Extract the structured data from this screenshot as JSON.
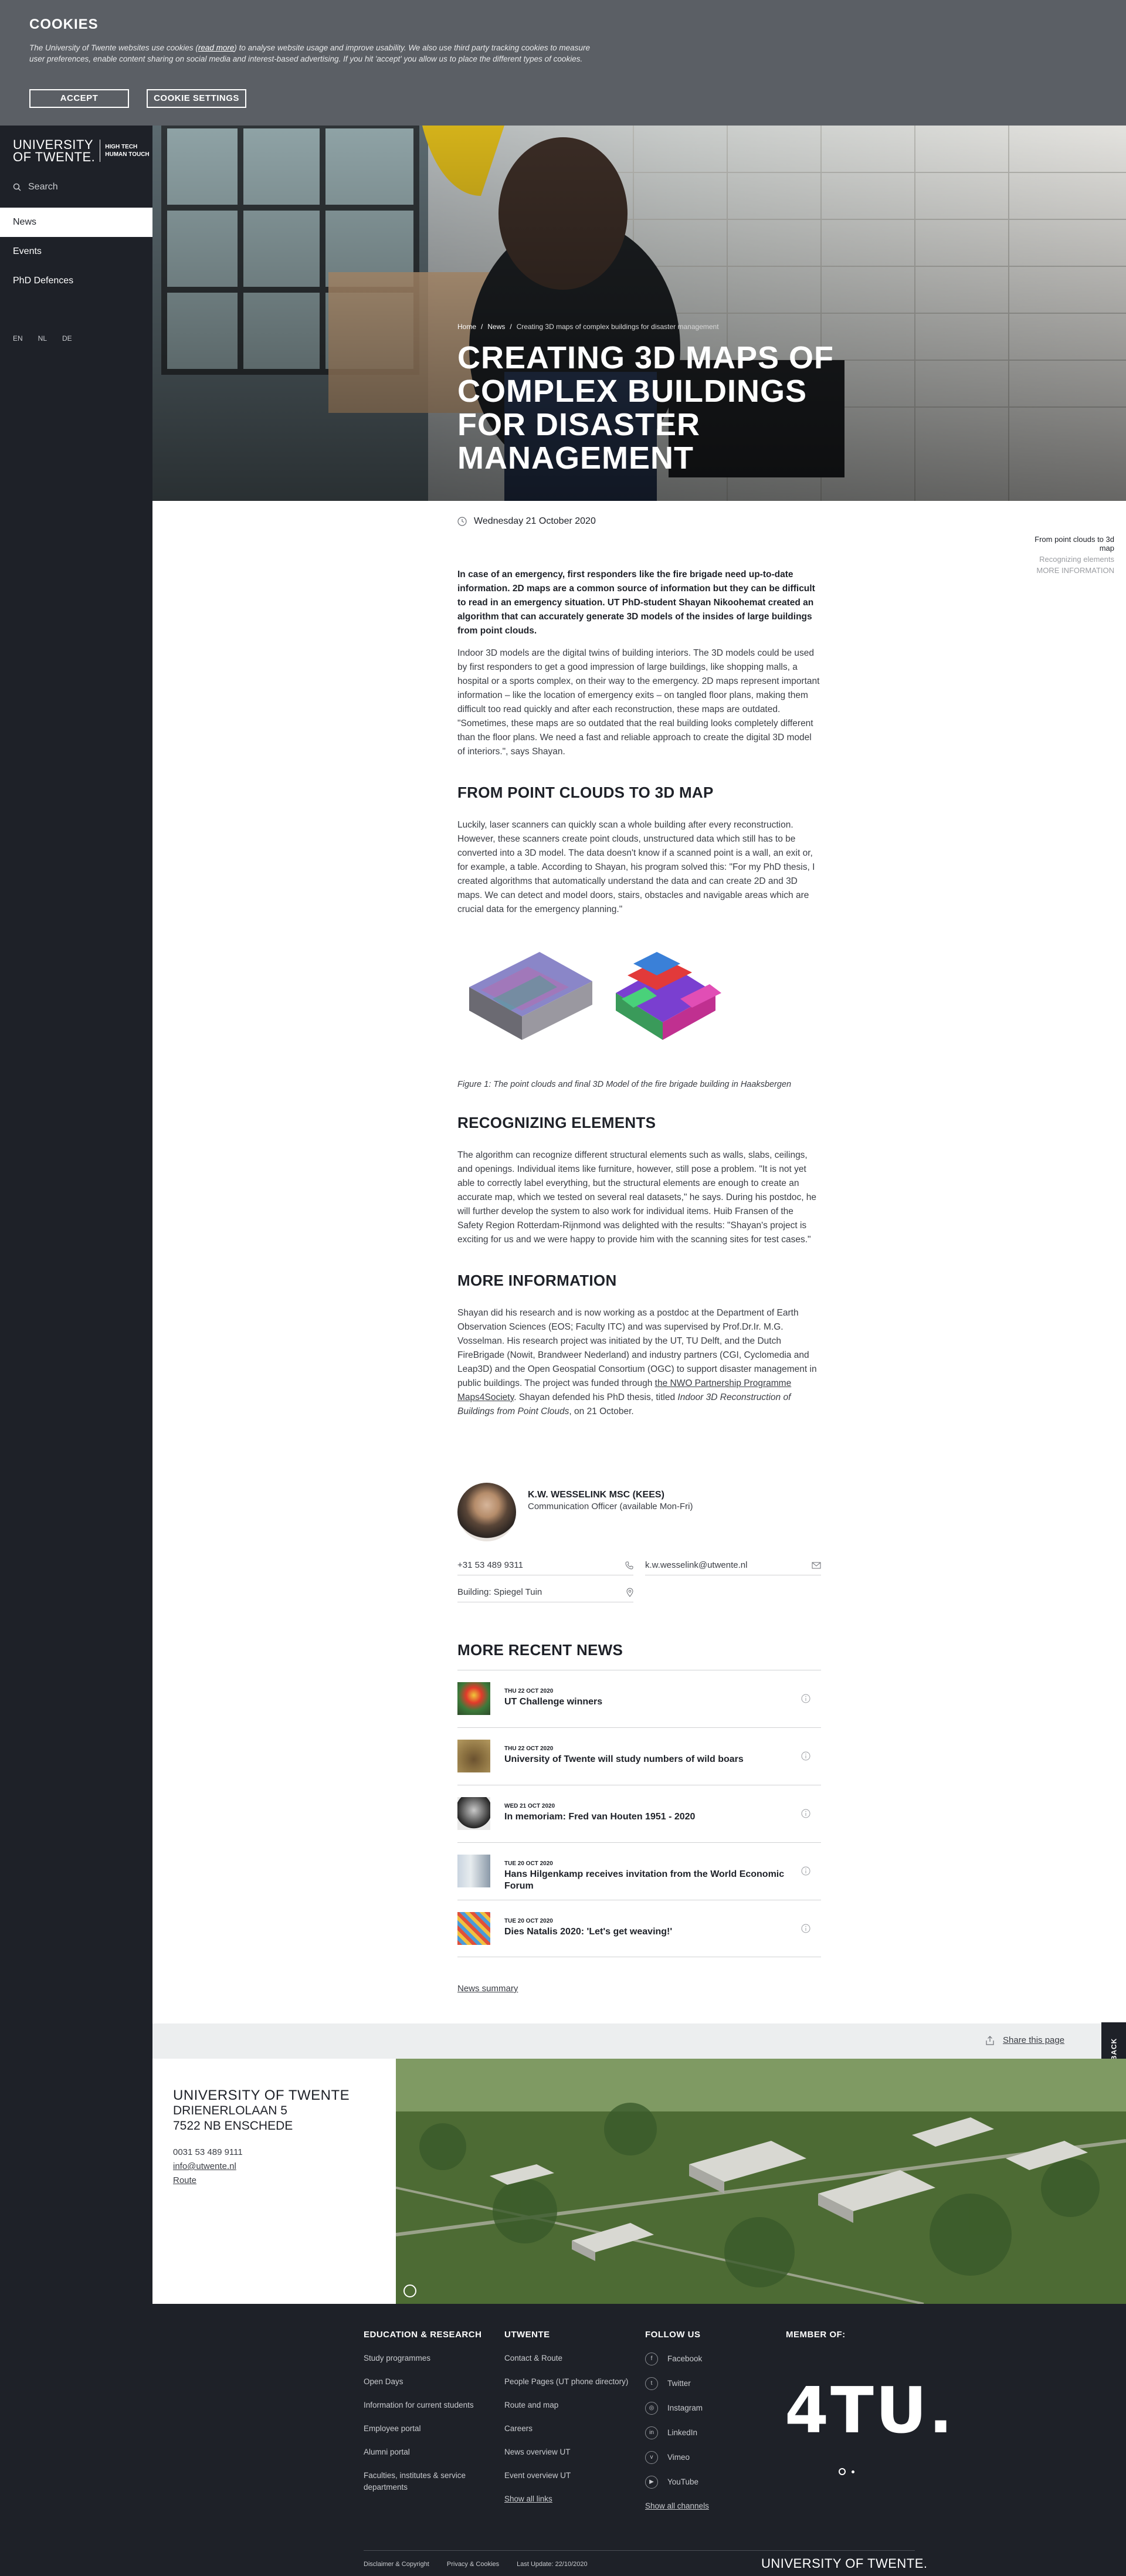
{
  "cookie": {
    "title": "COOKIES",
    "text_before": "The University of Twente websites use cookies (",
    "read_more": "read more",
    "text_after": ") to analyse website usage and improve usability. We also use third party tracking cookies to measure user preferences, enable content sharing on social media and interest-based advertising. If you hit 'accept' you allow us to place the different types of cookies.",
    "accept_label": "ACCEPT",
    "settings_label": "COOKIE SETTINGS"
  },
  "sidebar": {
    "logo_name_line1": "UNIVERSITY",
    "logo_name_line2": "OF TWENTE.",
    "logo_tag_line1": "HIGH TECH",
    "logo_tag_line2": "HUMAN TOUCH",
    "search_placeholder": "Search",
    "items": [
      {
        "label": "News",
        "active": true
      },
      {
        "label": "Events",
        "active": false
      },
      {
        "label": "PhD Defences",
        "active": false
      }
    ],
    "languages": [
      "EN",
      "NL",
      "DE"
    ]
  },
  "hero": {
    "breadcrumb": [
      "Home",
      "News",
      "Creating 3D maps of complex buildings for disaster management"
    ],
    "title": "CREATING 3D MAPS OF COMPLEX BUILDINGS FOR DISASTER MANAGEMENT"
  },
  "article": {
    "date": "Wednesday 21 October 2020",
    "lead": "In case of an emergency, first responders like the fire brigade need up-to-date information. 2D maps are a common source of information but they can be difficult to read in an emergency situation. UT PhD-student Shayan Nikoohemat created an algorithm that can accurately generate 3D models of the insides of large buildings from point clouds.",
    "p1": "Indoor 3D models are the digital twins of building interiors. The 3D models could be used by first responders to get a good impression of large buildings, like shopping malls, a hospital or a sports complex, on their way to the emergency. 2D maps represent important information – like the location of emergency exits – on tangled floor plans, making them difficult too read quickly and after each reconstruction, these maps are outdated. \"Sometimes, these maps are so outdated that the real building looks completely different than the floor plans. We need a fast and reliable approach to create the digital 3D model of interiors.\", says Shayan.",
    "h_point_clouds": "FROM POINT CLOUDS TO 3D MAP",
    "p2": "Luckily, laser scanners can quickly scan a whole building after every reconstruction. However, these scanners create point clouds, unstructured data which still has to be converted into a 3D model. The data doesn't know if a scanned point is a wall, an exit or, for example, a table. According to Shayan, his program solved this: \"For my PhD thesis, I created algorithms that automatically understand the data and can create 2D and 3D maps. We can detect and model doors, stairs, obstacles and navigable areas which are crucial data for the emergency planning.\"",
    "figure_caption": "Figure 1: The point clouds and final 3D Model of the fire brigade building in Haaksbergen",
    "h_recognizing": "RECOGNIZING ELEMENTS",
    "p3": "The algorithm can recognize different structural elements such as walls, slabs, ceilings, and openings. Individual items like furniture, however, still pose a problem. \"It is not yet able to correctly label everything, but the structural elements are enough to create an accurate map, which we tested on several real datasets,\" he says. During his postdoc, he will further develop the system to also work for individual items. Huib Fransen of the Safety Region Rotterdam-Rijnmond was delighted with the results: \"Shayan's project is exciting for us and we were happy to provide him with the scanning sites for test cases.\"",
    "h_more_info": "MORE INFORMATION",
    "p4_before": "Shayan did his research and is now working as a postdoc at the Department of Earth Observation Sciences (EOS; Faculty ITC) and was supervised by Prof.Dr.Ir. M.G. Vosselman. His research project was initiated by the UT, TU Delft, and the Dutch FireBrigade (Nowit, Brandweer Nederland) and industry partners (CGI, Cyclomedia and Leap3D) and the Open Geospatial Consortium (OGC) to support disaster management in public buildings. The project was funded through ",
    "p4_link": "the NWO Partnership Programme Maps4Society",
    "p4_mid": ". Shayan defended his PhD thesis, titled ",
    "p4_title": "Indoor 3D Reconstruction of Buildings from Point Clouds",
    "p4_after": ", on 21 October."
  },
  "toc": {
    "items": [
      "From point clouds to 3d map",
      "Recognizing elements",
      "More information"
    ]
  },
  "contact": {
    "name": "K.W. WESSELINK MSC (KEES)",
    "role": "Communication Officer (available Mon-Fri)",
    "phone": "+31 53 489 9311",
    "email": "k.w.wesselink@utwente.nl",
    "building": "Building: Spiegel Tuin"
  },
  "recent": {
    "title": "MORE RECENT NEWS",
    "items": [
      {
        "date": "THU 22 OCT 2020",
        "title": "UT Challenge winners"
      },
      {
        "date": "THU 22 OCT 2020",
        "title": "University of Twente will study numbers of wild boars"
      },
      {
        "date": "WED 21 OCT 2020",
        "title": "In memoriam: Fred van Houten 1951 - 2020"
      },
      {
        "date": "TUE 20 OCT 2020",
        "title": "Hans Hilgenkamp receives invitation from the World Economic Forum"
      },
      {
        "date": "TUE 20 OCT 2020",
        "title": "Dies Natalis 2020: 'Let's get weaving!'"
      }
    ],
    "summary_link": "News summary"
  },
  "share": {
    "label": "Share this page"
  },
  "feedback": {
    "label": "FEEDBACK"
  },
  "address": {
    "uni": "UNIVERSITY OF TWENTE",
    "street": "DRIENERLOLAAN 5",
    "city": "7522 NB ENSCHEDE",
    "phone": "0031 53 489 9111",
    "email": "info@utwente.nl",
    "route": "Route"
  },
  "footer": {
    "col1": {
      "title": "EDUCATION & RESEARCH",
      "links": [
        "Study programmes",
        "Open Days",
        "Information for current students",
        "Employee portal",
        "Alumni portal",
        "Faculties, institutes & service departments"
      ]
    },
    "col2": {
      "title": "UTWENTE",
      "links": [
        "Contact & Route",
        "People Pages (UT phone directory)",
        "Route and map",
        "Careers",
        "News overview UT",
        "Event overview UT"
      ],
      "show_all": "Show all links"
    },
    "col3": {
      "title": "FOLLOW US",
      "links": [
        "Facebook",
        "Twitter",
        "Instagram",
        "LinkedIn",
        "Vimeo",
        "YouTube"
      ],
      "show_all": "Show all channels"
    },
    "col4": {
      "title": "MEMBER OF:",
      "logo": "4TU."
    },
    "bottom_links": [
      "Disclaimer & Copyright",
      "Privacy & Cookies",
      "Last Update: 22/10/2020"
    ],
    "brand": "UNIVERSITY OF TWENTE."
  }
}
